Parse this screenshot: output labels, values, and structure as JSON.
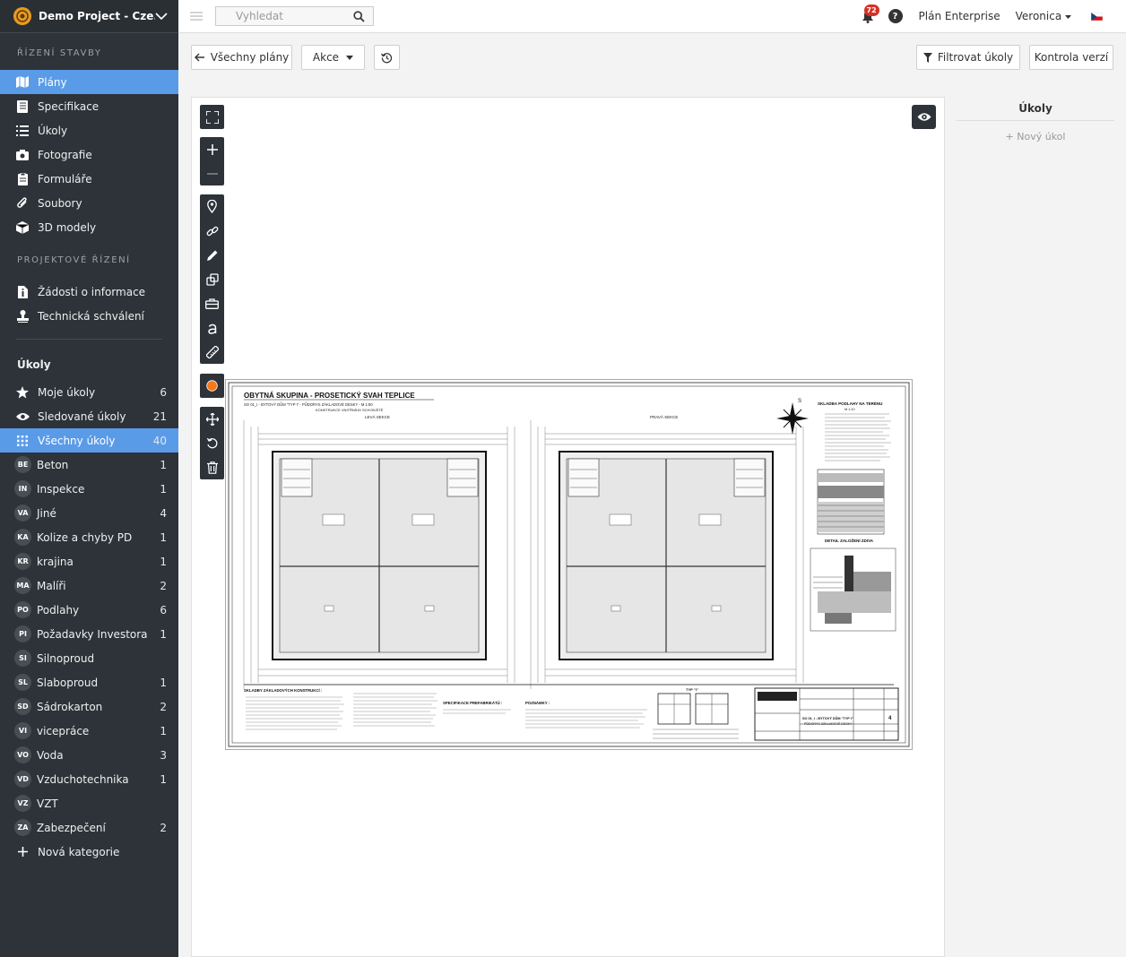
{
  "sidebar": {
    "project": "Demo Project - Cze...",
    "section_construction": "ŘÍZENÍ STAVBY",
    "construction_items": [
      {
        "label": "Plány",
        "icon": "map-icon"
      },
      {
        "label": "Specifikace",
        "icon": "book-icon"
      },
      {
        "label": "Úkoly",
        "icon": "list-icon"
      },
      {
        "label": "Fotografie",
        "icon": "camera-icon"
      },
      {
        "label": "Formuláře",
        "icon": "clipboard-icon"
      },
      {
        "label": "Soubory",
        "icon": "paperclip-icon"
      },
      {
        "label": "3D modely",
        "icon": "cube-icon"
      }
    ],
    "section_project": "PROJEKTOVÉ ŘÍZENÍ",
    "project_items": [
      {
        "label": "Žádosti o informace",
        "icon": "file-info-icon"
      },
      {
        "label": "Technická schválení",
        "icon": "stamp-icon"
      }
    ],
    "tasks_heading": "Úkoly",
    "task_filters": [
      {
        "label": "Moje úkoly",
        "count": "6",
        "icon": "star-icon"
      },
      {
        "label": "Sledované úkoly",
        "count": "21",
        "icon": "eye-icon"
      },
      {
        "label": "Všechny úkoly",
        "count": "40",
        "icon": "grid-icon"
      }
    ],
    "categories": [
      {
        "abbr": "BE",
        "label": "Beton",
        "count": "1"
      },
      {
        "abbr": "IN",
        "label": "Inspekce",
        "count": "1"
      },
      {
        "abbr": "VA",
        "label": "Jiné",
        "count": "4"
      },
      {
        "abbr": "KA",
        "label": "Kolize a chyby PD",
        "count": "1"
      },
      {
        "abbr": "KR",
        "label": "krajina",
        "count": "1"
      },
      {
        "abbr": "MA",
        "label": "Malíři",
        "count": "2"
      },
      {
        "abbr": "PO",
        "label": "Podlahy",
        "count": "6"
      },
      {
        "abbr": "PI",
        "label": "Požadavky Investora",
        "count": "1"
      },
      {
        "abbr": "SI",
        "label": "Silnoproud",
        "count": ""
      },
      {
        "abbr": "SL",
        "label": "Slaboproud",
        "count": "1"
      },
      {
        "abbr": "SD",
        "label": "Sádrokarton",
        "count": "2"
      },
      {
        "abbr": "VI",
        "label": "vicepráce",
        "count": "1"
      },
      {
        "abbr": "VO",
        "label": "Voda",
        "count": "3"
      },
      {
        "abbr": "VD",
        "label": "Vzduchotechnika",
        "count": "1"
      },
      {
        "abbr": "VZ",
        "label": "VZT",
        "count": ""
      },
      {
        "abbr": "ZA",
        "label": "Zabezpečení",
        "count": "2"
      }
    ],
    "new_category": "Nová kategorie"
  },
  "topbar": {
    "search_placeholder": "Vyhledat",
    "notifications": "72",
    "help": "?",
    "plan": "Plán Enterprise",
    "user": "Veronica"
  },
  "toolbar": {
    "all_plans": "Všechny plány",
    "actions": "Akce",
    "filter_tasks": "Filtrovat úkoly",
    "version_check": "Kontrola verzí"
  },
  "drawing": {
    "title": "OBYTNÁ SKUPINA - PROSETICKÝ SVAH TEPLICE",
    "subtitle1": "SO 01_I - BYTOVÝ DŮM \"TYP I\" - PŮDORYS ZÁKLADOVÉ DESKY - M 1:50",
    "subtitle2": "KONSTRUKCE VNITŘNÍHO SCHODIŠTĚ",
    "left_section": "LEVÁ SEKCE",
    "right_section": "PRAVÁ SEKCE",
    "floor_title": "SKLADBA PODLAHY NA TERÉNU",
    "scale": "M 1:10",
    "detail_title": "DETAIL ZALOŽENÍ ZDIVA",
    "layers_title": "SKLADBY ZÁKLADOVÝCH KONSTRUKCÍ :",
    "prefab_title": "SPECIFIKACE PREFABRIKÁTŮ :",
    "notes_title": "POZNÁMKY :",
    "type_label": "TYP \"I\"",
    "stamp_title": "SO 01_I - BYTOVÝ DŮM \"TYP I\"",
    "stamp_sub": "PŮDORYS ZÁKLADOVÉ DESKY",
    "sheet_no": "4"
  },
  "right_panel": {
    "title": "Úkoly",
    "new_task": "+ Nový úkol"
  }
}
